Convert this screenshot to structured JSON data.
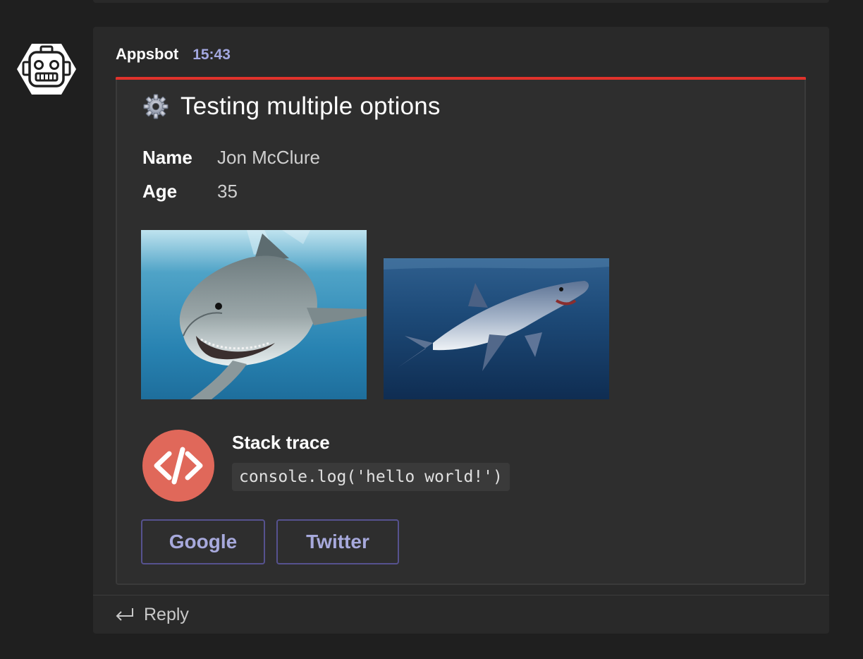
{
  "message": {
    "sender": "Appsbot",
    "time": "15:43",
    "accent_color": "#e0322b"
  },
  "card": {
    "title": "Testing multiple options",
    "title_icon": "gear-icon",
    "facts": [
      {
        "key": "Name",
        "value": "Jon McClure"
      },
      {
        "key": "Age",
        "value": "35"
      }
    ],
    "images": [
      {
        "name": "great-white-shark-image"
      },
      {
        "name": "mako-shark-image"
      }
    ],
    "stack": {
      "icon": "code-icon",
      "title": "Stack trace",
      "code": "console.log('hello world!')"
    },
    "actions": [
      {
        "label": "Google"
      },
      {
        "label": "Twitter"
      }
    ]
  },
  "reply": {
    "label": "Reply",
    "icon": "reply-arrow-icon"
  }
}
